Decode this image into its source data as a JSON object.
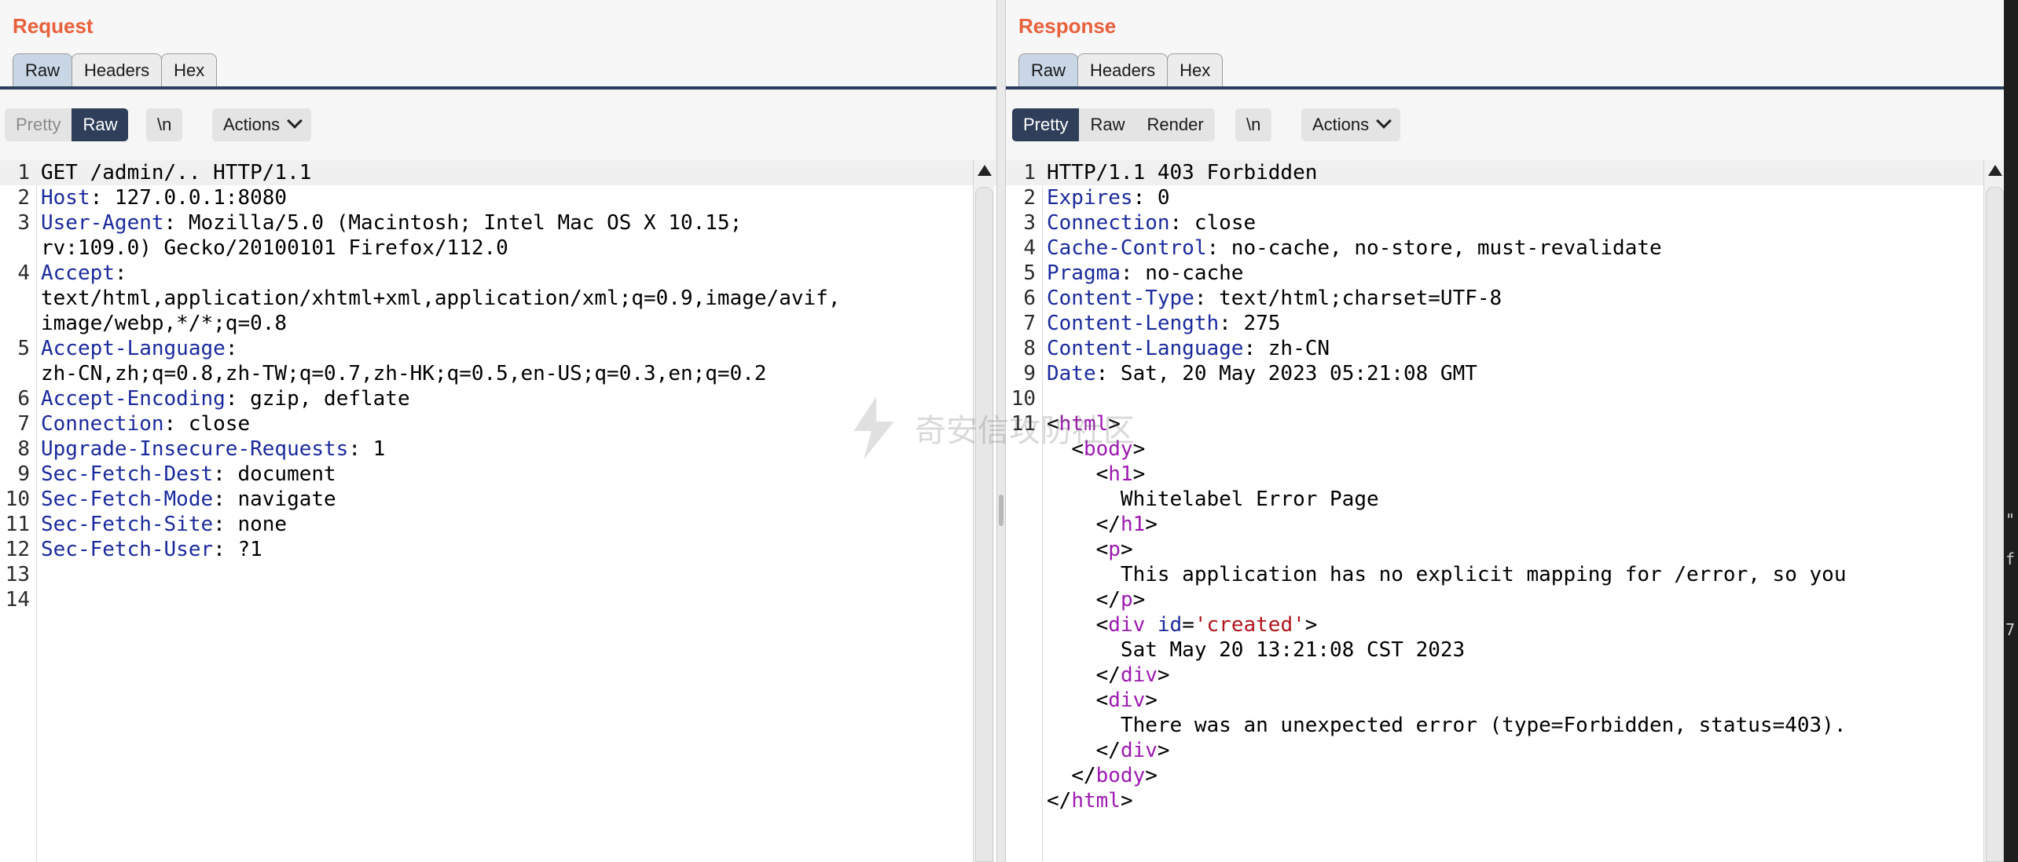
{
  "request": {
    "title": "Request",
    "tabs": [
      "Raw",
      "Headers",
      "Hex"
    ],
    "active_tab": "Raw",
    "toolbar": {
      "pretty": "Pretty",
      "raw": "Raw",
      "newline": "\\n",
      "actions": "Actions"
    },
    "lines": [
      {
        "no": "1",
        "html": "GET /admin/.. HTTP/1.1"
      },
      {
        "no": "2",
        "key": "Host",
        "rest": ": 127.0.0.1:8080"
      },
      {
        "no": "3",
        "key": "User-Agent",
        "rest": ": Mozilla/5.0 (Macintosh; Intel Mac OS X 10.15;"
      },
      {
        "no": "",
        "cont": "rv:109.0) Gecko/20100101 Firefox/112.0"
      },
      {
        "no": "4",
        "key": "Accept",
        "rest": ":"
      },
      {
        "no": "",
        "cont": "text/html,application/xhtml+xml,application/xml;q=0.9,image/avif,"
      },
      {
        "no": "",
        "cont": "image/webp,*/*;q=0.8"
      },
      {
        "no": "5",
        "key": "Accept-Language",
        "rest": ":"
      },
      {
        "no": "",
        "cont": "zh-CN,zh;q=0.8,zh-TW;q=0.7,zh-HK;q=0.5,en-US;q=0.3,en;q=0.2"
      },
      {
        "no": "6",
        "key": "Accept-Encoding",
        "rest": ": gzip, deflate"
      },
      {
        "no": "7",
        "key": "Connection",
        "rest": ": close"
      },
      {
        "no": "8",
        "key": "Upgrade-Insecure-Requests",
        "rest": ": 1"
      },
      {
        "no": "9",
        "key": "Sec-Fetch-Dest",
        "rest": ": document"
      },
      {
        "no": "10",
        "key": "Sec-Fetch-Mode",
        "rest": ": navigate"
      },
      {
        "no": "11",
        "key": "Sec-Fetch-Site",
        "rest": ": none"
      },
      {
        "no": "12",
        "key": "Sec-Fetch-User",
        "rest": ": ?1"
      },
      {
        "no": "13",
        "cont": ""
      },
      {
        "no": "14",
        "cont": ""
      }
    ]
  },
  "response": {
    "title": "Response",
    "tabs": [
      "Raw",
      "Headers",
      "Hex"
    ],
    "active_tab": "Raw",
    "toolbar": {
      "pretty": "Pretty",
      "raw": "Raw",
      "render": "Render",
      "newline": "\\n",
      "actions": "Actions"
    },
    "lines": [
      {
        "no": "1",
        "cont": "HTTP/1.1 403 Forbidden"
      },
      {
        "no": "2",
        "key": "Expires",
        "rest": ": 0"
      },
      {
        "no": "3",
        "key": "Connection",
        "rest": ": close"
      },
      {
        "no": "4",
        "key": "Cache-Control",
        "rest": ": no-cache, no-store, must-revalidate"
      },
      {
        "no": "5",
        "key": "Pragma",
        "rest": ": no-cache"
      },
      {
        "no": "6",
        "key": "Content-Type",
        "rest": ": text/html;charset=UTF-8"
      },
      {
        "no": "7",
        "key": "Content-Length",
        "rest": ": 275"
      },
      {
        "no": "8",
        "key": "Content-Language",
        "rest": ": zh-CN"
      },
      {
        "no": "9",
        "key": "Date",
        "rest": ": Sat, 20 May 2023 05:21:08 GMT"
      },
      {
        "no": "10",
        "cont": ""
      },
      {
        "no": "11",
        "indent": "",
        "open": "<",
        "tag": "html",
        "close": ">"
      },
      {
        "no": "",
        "indent": "  ",
        "open": "<",
        "tag": "body",
        "close": ">"
      },
      {
        "no": "",
        "indent": "    ",
        "open": "<",
        "tag": "h1",
        "close": ">"
      },
      {
        "no": "",
        "cont": "      Whitelabel Error Page"
      },
      {
        "no": "",
        "indent": "    ",
        "open": "</",
        "tag": "h1",
        "close": ">"
      },
      {
        "no": "",
        "indent": "    ",
        "open": "<",
        "tag": "p",
        "close": ">"
      },
      {
        "no": "",
        "cont": "      This application has no explicit mapping for /error, so you"
      },
      {
        "no": "",
        "indent": "    ",
        "open": "</",
        "tag": "p",
        "close": ">"
      },
      {
        "no": "",
        "indent": "    ",
        "open": "<",
        "tag": "div",
        "attr": " id",
        "eq": "=",
        "val": "'created'",
        "close": ">"
      },
      {
        "no": "",
        "cont": "      Sat May 20 13:21:08 CST 2023"
      },
      {
        "no": "",
        "indent": "    ",
        "open": "</",
        "tag": "div",
        "close": ">"
      },
      {
        "no": "",
        "indent": "    ",
        "open": "<",
        "tag": "div",
        "close": ">"
      },
      {
        "no": "",
        "cont": "      There was an unexpected error (type=Forbidden, status=403)."
      },
      {
        "no": "",
        "indent": "    ",
        "open": "</",
        "tag": "div",
        "close": ">"
      },
      {
        "no": "",
        "indent": "  ",
        "open": "</",
        "tag": "body",
        "close": ">"
      },
      {
        "no": "",
        "indent": "",
        "open": "</",
        "tag": "html",
        "close": ">"
      }
    ]
  },
  "watermark": "奇安信攻防社区",
  "right_strip_chars": [
    "\"",
    "f",
    "7"
  ],
  "colors": {
    "title": "#e8613c",
    "header_key": "#1a2a9c",
    "tag": "#9c1ab0",
    "attr_value": "#b0141b",
    "active_button": "#2f3e59"
  }
}
